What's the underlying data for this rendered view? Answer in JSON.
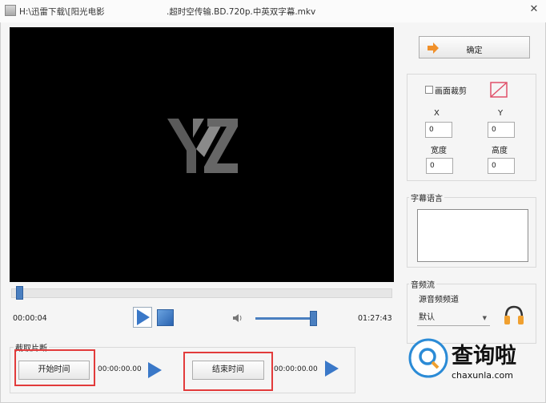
{
  "window": {
    "title_path": "H:\\迅雷下载\\[阳光电影",
    "title_file": ".超时空传输.BD.720p.中英双字幕.mkv",
    "close_glyph": "✕"
  },
  "player": {
    "current_time": "00:00:04",
    "total_time": "01:27:43",
    "seek_progress": 0.02,
    "volume_level": 0.9
  },
  "clip": {
    "group_title": "截取片断",
    "start_button": "开始时间",
    "start_value": "00:00:00.00",
    "end_button": "结束时间",
    "end_value": "00:00:00.00"
  },
  "confirm_button": "确定",
  "crop": {
    "checkbox_label": "画面裁剪",
    "x_label": "X",
    "y_label": "Y",
    "x_value": "0",
    "y_value": "0",
    "width_label": "宽度",
    "height_label": "高度",
    "width_value": "0",
    "height_value": "0"
  },
  "subtitle": {
    "group_title": "字幕语言"
  },
  "audio": {
    "group_title": "音频流",
    "source_label": "源音频频道",
    "selected": "默认"
  },
  "watermark": {
    "site": "chaxunla.com",
    "brand": "查询啦"
  },
  "colors": {
    "accent": "#4a7fc0",
    "highlight": "#e23b3b",
    "video_bg": "#000000"
  }
}
